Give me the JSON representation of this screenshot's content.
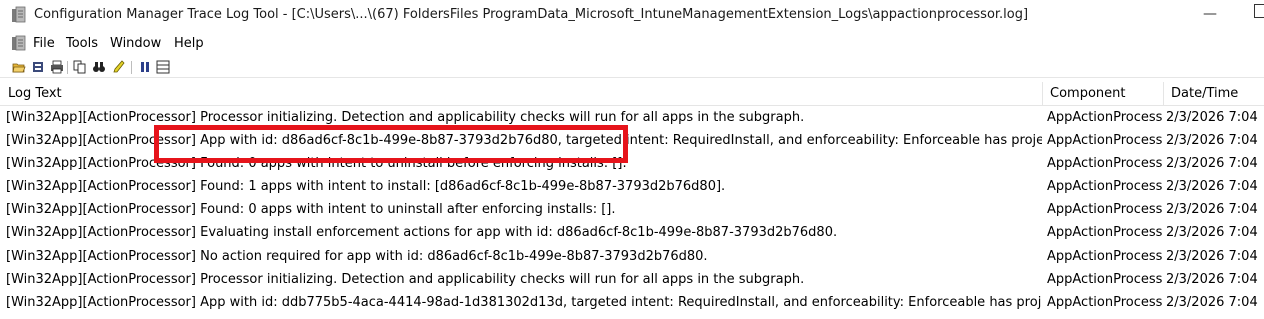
{
  "window": {
    "title": "Configuration Manager Trace Log Tool - [C:\\Users\\...\\(67) FoldersFiles ProgramData_Microsoft_IntuneManagementExtension_Logs\\appactionprocessor.log]",
    "minimize_glyph": "—"
  },
  "menu": {
    "items": [
      "File",
      "Tools",
      "Window",
      "Help"
    ]
  },
  "toolbar": {
    "icons": [
      "open-icon",
      "print-preview-icon",
      "print-icon",
      "copy-icon",
      "find-icon",
      "highlight-icon",
      "pause-icon",
      "columns-icon"
    ]
  },
  "table": {
    "columns": [
      "Log Text",
      "Component",
      "Date/Time"
    ],
    "rows": [
      {
        "text": "[Win32App][ActionProcessor] Processor initializing. Detection and applicability checks will run for all apps in the subgraph.",
        "component": "AppActionProcess",
        "datetime": "2/3/2026 7:04"
      },
      {
        "text": "[Win32App][ActionProcessor] App with id: d86ad6cf-8c1b-499e-8b87-3793d2b76d80, targeted intent: RequiredInstall, and enforceability: Enforceable has projec...",
        "component": "AppActionProcess",
        "datetime": "2/3/2026 7:04"
      },
      {
        "text": "[Win32App][ActionProcessor] Found: 0 apps with intent to uninstall before enforcing installs: [].",
        "component": "AppActionProcess",
        "datetime": "2/3/2026 7:04"
      },
      {
        "text": "[Win32App][ActionProcessor] Found: 1 apps with intent to install: [d86ad6cf-8c1b-499e-8b87-3793d2b76d80].",
        "component": "AppActionProcess",
        "datetime": "2/3/2026 7:04"
      },
      {
        "text": "[Win32App][ActionProcessor] Found: 0 apps with intent to uninstall after enforcing installs: [].",
        "component": "AppActionProcess",
        "datetime": "2/3/2026 7:04"
      },
      {
        "text": "[Win32App][ActionProcessor] Evaluating install enforcement actions for app with id: d86ad6cf-8c1b-499e-8b87-3793d2b76d80.",
        "component": "AppActionProcess",
        "datetime": "2/3/2026 7:04"
      },
      {
        "text": "[Win32App][ActionProcessor] No action required for app with id: d86ad6cf-8c1b-499e-8b87-3793d2b76d80.",
        "component": "AppActionProcess",
        "datetime": "2/3/2026 7:04"
      },
      {
        "text": "[Win32App][ActionProcessor] Processor initializing. Detection and applicability checks will run for all apps in the subgraph.",
        "component": "AppActionProcess",
        "datetime": "2/3/2026 7:04"
      },
      {
        "text": "[Win32App][ActionProcessor] App with id: ddb775b5-4aca-4414-98ad-1d381302d13d, targeted intent: RequiredInstall, and enforceability: Enforceable has proje...",
        "component": "AppActionProcess",
        "datetime": "2/3/2026 7:04"
      }
    ]
  },
  "annotation": {
    "color": "#e6141b"
  }
}
